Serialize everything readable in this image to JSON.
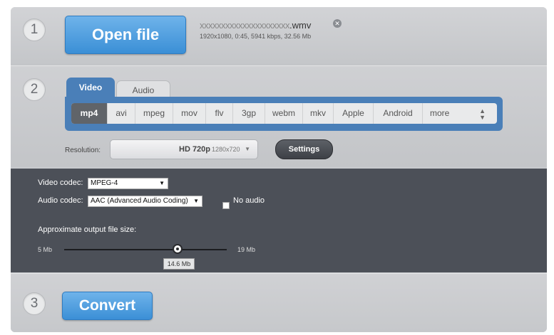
{
  "steps": {
    "one": "1",
    "two": "2",
    "three": "3"
  },
  "open_file": {
    "label": "Open file"
  },
  "file": {
    "name_masked": "xxxxxxxxxxxxxxxxxxxxx",
    "extension": ".wmv",
    "meta": "1920x1080, 0:45, 5941 kbps, 32.56 Mb",
    "remove_icon": "close-circle-icon"
  },
  "tabs": [
    {
      "label": "Video",
      "active": true
    },
    {
      "label": "Audio",
      "active": false
    }
  ],
  "formats": [
    {
      "label": "mp4",
      "selected": true
    },
    {
      "label": "avi"
    },
    {
      "label": "mpeg"
    },
    {
      "label": "mov"
    },
    {
      "label": "flv"
    },
    {
      "label": "3gp"
    },
    {
      "label": "webm"
    },
    {
      "label": "mkv"
    },
    {
      "label": "Apple"
    },
    {
      "label": "Android"
    },
    {
      "label": "more"
    }
  ],
  "resolution": {
    "label": "Resolution:",
    "value": "HD 720p",
    "detail": "1280x720",
    "settings_label": "Settings"
  },
  "codecs": {
    "video_label": "Video codec:",
    "video_value": "MPEG-4",
    "audio_label": "Audio codec:",
    "audio_value": "AAC (Advanced Audio Coding)",
    "no_audio_label": "No audio",
    "no_audio_checked": false
  },
  "filesize": {
    "label": "Approximate output file size:",
    "min": "5 Mb",
    "max": "19 Mb",
    "value": "14.6 Mb",
    "fraction": 0.69
  },
  "convert": {
    "label": "Convert"
  },
  "colors": {
    "accent": "#4a7fb8",
    "button_blue": "#3b8fd6",
    "dark_panel": "#4c5058"
  }
}
